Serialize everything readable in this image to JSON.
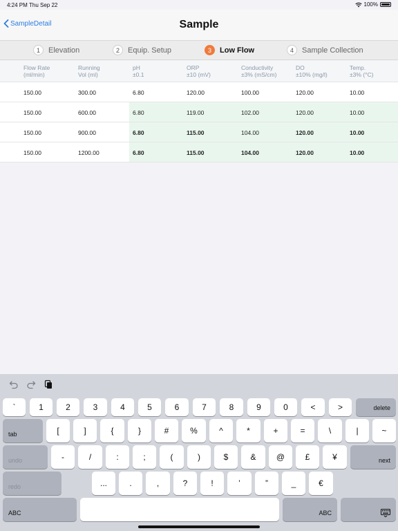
{
  "status": {
    "time": "4:24 PM",
    "date": "Thu Sep 22",
    "battery": "100%"
  },
  "nav": {
    "back_label": "SampleDetail",
    "title": "Sample"
  },
  "steps": [
    {
      "num": "1",
      "label": "Elevation"
    },
    {
      "num": "2",
      "label": "Equip. Setup"
    },
    {
      "num": "3",
      "label": "Low Flow"
    },
    {
      "num": "4",
      "label": "Sample Collection"
    }
  ],
  "table": {
    "headers": [
      {
        "line1": "Flow Rate",
        "line2": "(ml/min)"
      },
      {
        "line1": "Running",
        "line2": "Vol (ml)"
      },
      {
        "line1": "pH",
        "line2": "±0.1"
      },
      {
        "line1": "ORP",
        "line2": "±10 (mV)"
      },
      {
        "line1": "Conductivity",
        "line2": "±3% (mS/cm)"
      },
      {
        "line1": "DO",
        "line2": "±10% (mg/l)"
      },
      {
        "line1": "Temp.",
        "line2": "±3% (°C)"
      }
    ],
    "rows": [
      [
        "150.00",
        "300.00",
        "6.80",
        "120.00",
        "100.00",
        "120.00",
        "10.00"
      ],
      [
        "150.00",
        "600.00",
        "6.80",
        "119.00",
        "102.00",
        "120.00",
        "10.00"
      ],
      [
        "150.00",
        "900.00",
        "6.80",
        "115.00",
        "104.00",
        "120.00",
        "10.00"
      ],
      [
        "150.00",
        "1200.00",
        "6.80",
        "115.00",
        "104.00",
        "120.00",
        "10.00"
      ]
    ],
    "highlight_color": "#e9f6ee"
  },
  "keyboard": {
    "row1": [
      "`",
      "1",
      "2",
      "3",
      "4",
      "5",
      "6",
      "7",
      "8",
      "9",
      "0",
      "<",
      ">"
    ],
    "delete": "delete",
    "tab": "tab",
    "row2": [
      "[",
      "]",
      "{",
      "}",
      "#",
      "%",
      "^",
      "*",
      "+",
      "=",
      "\\",
      "|",
      "~"
    ],
    "undo": "undo",
    "row3": [
      "-",
      "/",
      ":",
      ";",
      "(",
      ")",
      "$",
      "&",
      "@",
      "£",
      "¥"
    ],
    "next": "next",
    "redo": "redo",
    "row4": [
      "...",
      ".",
      ",",
      "?",
      "!",
      "’",
      "”",
      "_",
      "€"
    ],
    "abc_left": "ABC",
    "abc_right": "ABC"
  },
  "accent_color": "#2a7de1",
  "step_active_color": "#f07a3c"
}
